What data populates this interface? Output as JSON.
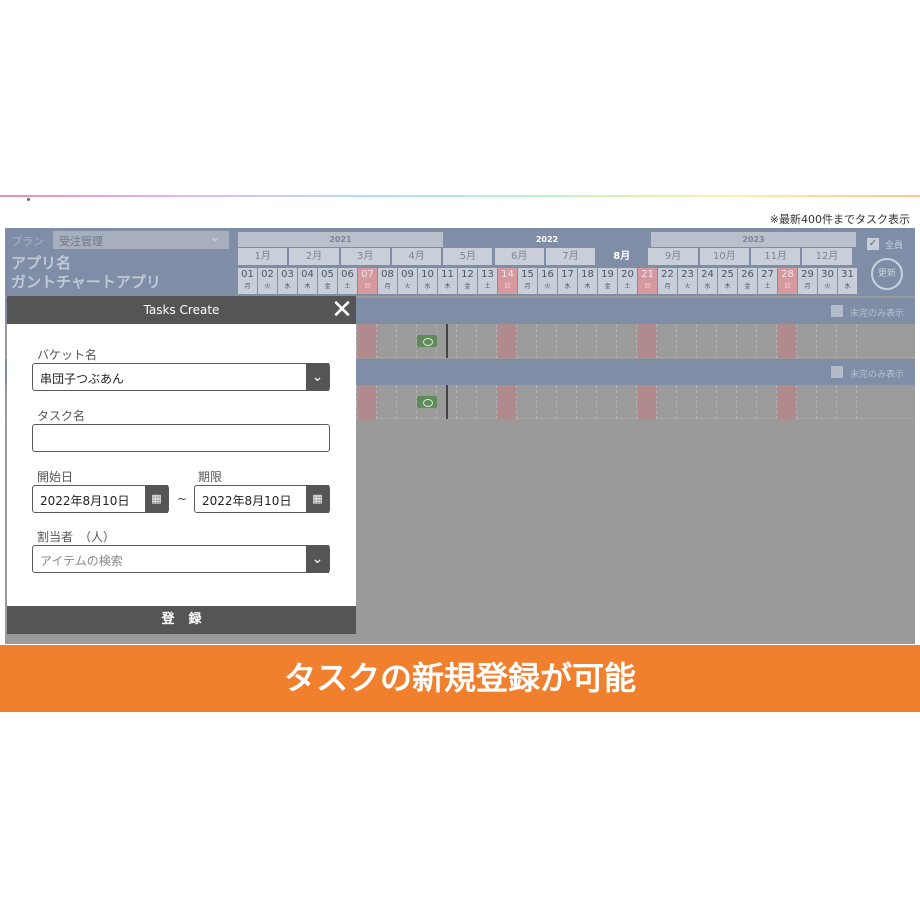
{
  "notice": "※最新400件までタスク表示",
  "header": {
    "plan_label": "プラン",
    "plan_value": "受注管理",
    "app_title_1": "アプリ名",
    "app_title_2": "ガントチャートアプリ",
    "all_label": "全員",
    "refresh_label": "更新"
  },
  "years": [
    "2021",
    "2022",
    "2023"
  ],
  "months": [
    "1月",
    "2月",
    "3月",
    "4月",
    "5月",
    "6月",
    "7月",
    "8月",
    "9月",
    "10月",
    "11月",
    "12月"
  ],
  "current_month": "8月",
  "days": [
    {
      "n": "01",
      "w": "月"
    },
    {
      "n": "02",
      "w": "火"
    },
    {
      "n": "03",
      "w": "水"
    },
    {
      "n": "04",
      "w": "木"
    },
    {
      "n": "05",
      "w": "金"
    },
    {
      "n": "06",
      "w": "土"
    },
    {
      "n": "07",
      "w": "日",
      "red": true
    },
    {
      "n": "08",
      "w": "月"
    },
    {
      "n": "09",
      "w": "火"
    },
    {
      "n": "10",
      "w": "水"
    },
    {
      "n": "11",
      "w": "木"
    },
    {
      "n": "12",
      "w": "金"
    },
    {
      "n": "13",
      "w": "土"
    },
    {
      "n": "14",
      "w": "日",
      "red": true
    },
    {
      "n": "15",
      "w": "月"
    },
    {
      "n": "16",
      "w": "火"
    },
    {
      "n": "17",
      "w": "水"
    },
    {
      "n": "18",
      "w": "木"
    },
    {
      "n": "19",
      "w": "金"
    },
    {
      "n": "20",
      "w": "土"
    },
    {
      "n": "21",
      "w": "日",
      "red": true
    },
    {
      "n": "22",
      "w": "月"
    },
    {
      "n": "23",
      "w": "火"
    },
    {
      "n": "24",
      "w": "水"
    },
    {
      "n": "25",
      "w": "木"
    },
    {
      "n": "26",
      "w": "金"
    },
    {
      "n": "27",
      "w": "土"
    },
    {
      "n": "28",
      "w": "日",
      "red": true
    },
    {
      "n": "29",
      "w": "月"
    },
    {
      "n": "30",
      "w": "火"
    },
    {
      "n": "31",
      "w": "水"
    }
  ],
  "bucket_filter_label": "未完のみ表示",
  "dialog": {
    "title": "Tasks Create",
    "bucket_label": "バケット名",
    "bucket_value": "串団子つぶあん",
    "task_label": "タスク名",
    "task_value": "",
    "start_label": "開始日",
    "start_value": "2022年8月10日",
    "due_label": "期限",
    "due_value": "2022年8月10日",
    "tilde": "~",
    "assignee_label": "割当者　（人）",
    "assignee_placeholder": "アイテムの検索",
    "submit_label": "登録"
  },
  "banner": "タスクの新規登録が可能",
  "icons": {
    "close": "close-icon",
    "chevron": "chevron-down-icon",
    "calendar": "calendar-icon",
    "refresh": "refresh-icon"
  }
}
